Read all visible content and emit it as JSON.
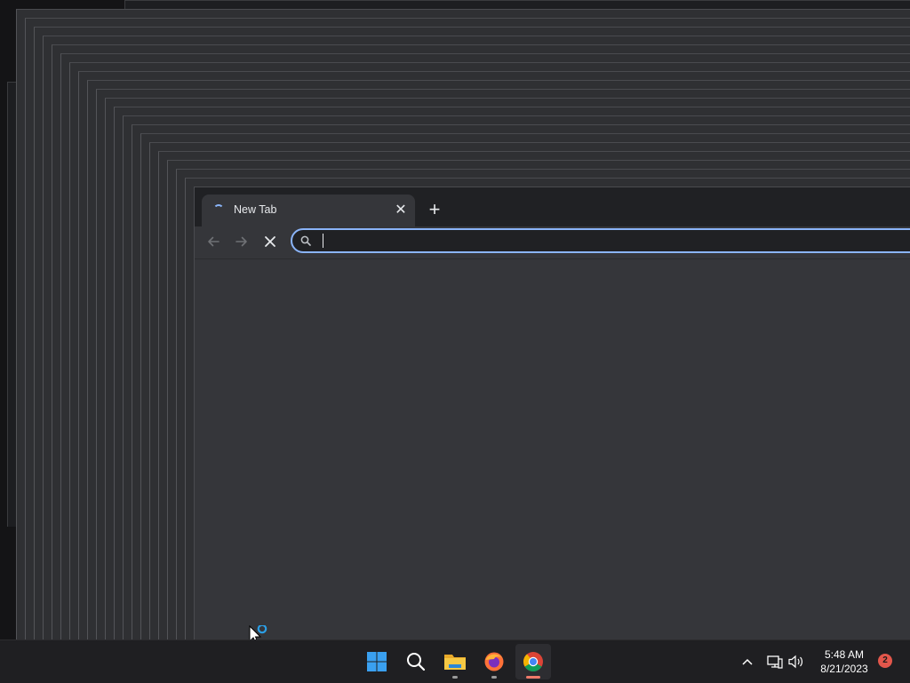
{
  "browser": {
    "tab": {
      "title": "New Tab",
      "close_symbol": "✕"
    },
    "new_tab_symbol": "+",
    "omnibox": {
      "value": "",
      "placeholder": ""
    },
    "nav": {
      "back_icon": "arrow-left-icon",
      "forward_icon": "arrow-right-icon",
      "stop_icon": "close-icon"
    },
    "colors": {
      "accent": "#8ab4f8",
      "frame": "#202124",
      "surface": "#35363a"
    }
  },
  "taskbar": {
    "apps": [
      {
        "name": "Start",
        "icon": "windows-logo-icon"
      },
      {
        "name": "Search",
        "icon": "search-icon"
      },
      {
        "name": "File Explorer",
        "icon": "folder-icon",
        "running": true
      },
      {
        "name": "Firefox",
        "icon": "firefox-icon",
        "running": true
      },
      {
        "name": "Chrome",
        "icon": "chrome-icon",
        "running": true,
        "active": true
      }
    ],
    "tray": {
      "chevron_icon": "chevron-up-icon",
      "network_icon": "network-icon",
      "volume_icon": "volume-icon"
    },
    "clock": {
      "time": "5:48 AM",
      "date": "8/21/2023"
    },
    "notifications": {
      "count": "2"
    }
  }
}
